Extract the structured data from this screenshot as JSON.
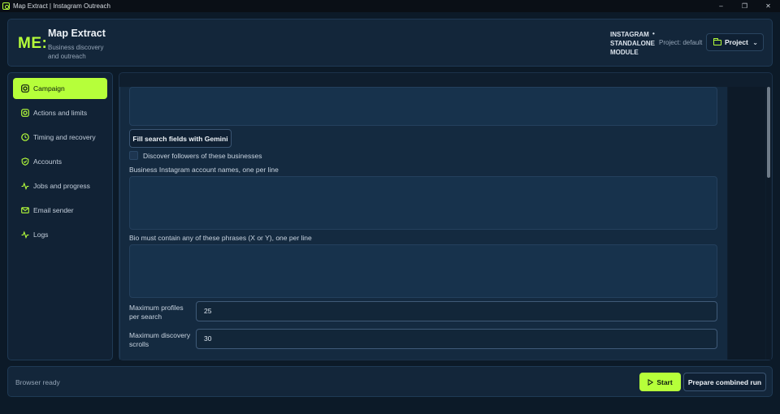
{
  "window": {
    "title": "Map Extract | Instagram Outreach",
    "minimize": "–",
    "maximize": "❐",
    "close": "✕"
  },
  "header": {
    "logo": "ME:",
    "title": "Map Extract",
    "subtitle": "Business discovery and outreach",
    "module": "INSTAGRAM STANDALONE MODULE",
    "dot": "•",
    "project_text": "Project: default",
    "project_button": "Project",
    "project_chevron": "⌄"
  },
  "sidebar": {
    "items": [
      {
        "label": "Campaign",
        "icon": "instagram-icon",
        "active": true
      },
      {
        "label": "Actions and limits",
        "icon": "instagram-icon",
        "active": false
      },
      {
        "label": "Timing and recovery",
        "icon": "clock-icon",
        "active": false
      },
      {
        "label": "Accounts",
        "icon": "shield-icon",
        "active": false
      },
      {
        "label": "Jobs and progress",
        "icon": "activity-icon",
        "active": false
      },
      {
        "label": "Email sender",
        "icon": "mail-icon",
        "active": false
      },
      {
        "label": "Logs",
        "icon": "activity-icon",
        "active": false
      }
    ]
  },
  "main": {
    "gemini_button": "Fill search fields with Gemini",
    "discover_followers_label": "Discover followers of these businesses",
    "account_names_label": "Business Instagram account names, one per line",
    "bio_phrases_label": "Bio must contain any of these phrases (X or Y), one per line",
    "max_profiles_label": "Maximum profiles per search",
    "max_profiles_value": "25",
    "max_scrolls_label": "Maximum discovery scrolls",
    "max_scrolls_value": "30"
  },
  "footer": {
    "status": "Browser ready",
    "start_button": "Start",
    "combined_button": "Prepare combined run"
  },
  "colors": {
    "accent": "#b6ff3a",
    "background": "#0c1a28",
    "panel": "#13263a"
  }
}
